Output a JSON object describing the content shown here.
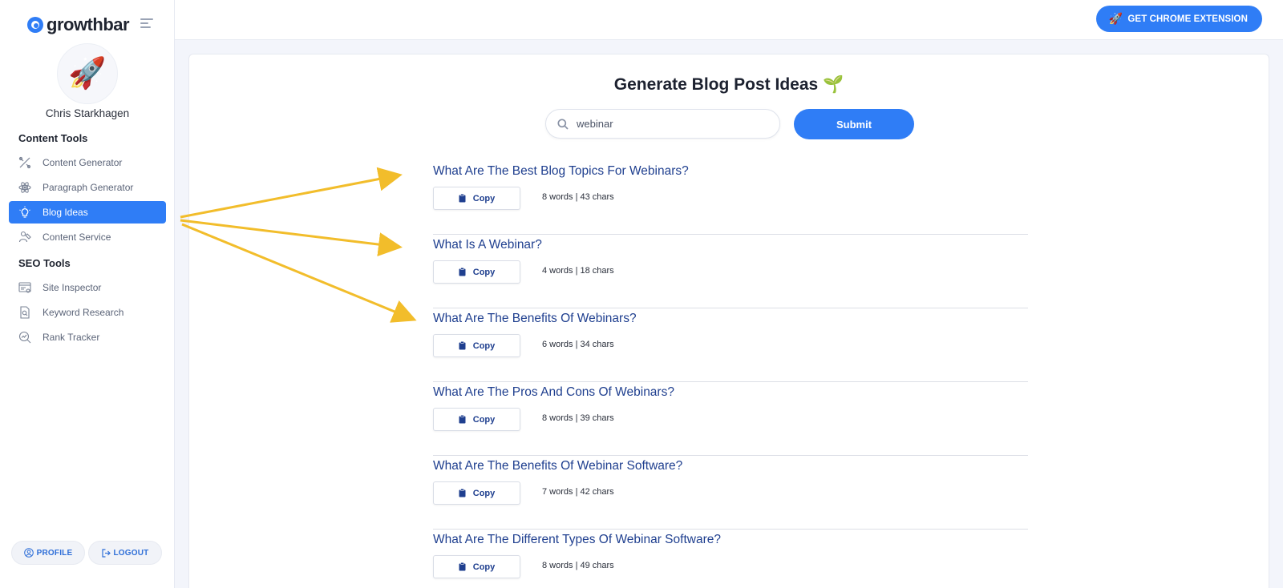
{
  "app": {
    "logo_text": "growthbar"
  },
  "user": {
    "name": "Chris Starkhagen",
    "avatar_emoji": "🚀"
  },
  "sidebar": {
    "sections": [
      {
        "title": "Content Tools",
        "items": [
          {
            "label": "Content Generator",
            "icon": "tools-icon"
          },
          {
            "label": "Paragraph Generator",
            "icon": "atom-icon"
          },
          {
            "label": "Blog Ideas",
            "icon": "lightbulb-icon",
            "active": true
          },
          {
            "label": "Content Service",
            "icon": "writer-icon"
          }
        ]
      },
      {
        "title": "SEO Tools",
        "items": [
          {
            "label": "Site Inspector",
            "icon": "browser-icon"
          },
          {
            "label": "Keyword Research",
            "icon": "document-search-icon"
          },
          {
            "label": "Rank Tracker",
            "icon": "magnify-chart-icon"
          }
        ]
      }
    ],
    "profile_label": "PROFILE",
    "logout_label": "LOGOUT"
  },
  "topbar": {
    "chrome_button_label": "GET CHROME EXTENSION",
    "chrome_button_emoji": "🚀"
  },
  "main": {
    "title": "Generate Blog Post Ideas",
    "title_emoji": "🌱",
    "search": {
      "value": "webinar",
      "placeholder": ""
    },
    "submit_label": "Submit",
    "copy_label": "Copy",
    "results": [
      {
        "title": "What Are The Best Blog Topics For Webinars?",
        "meta": "8 words | 43 chars"
      },
      {
        "title": "What Is A Webinar?",
        "meta": "4 words | 18 chars"
      },
      {
        "title": "What Are The Benefits Of Webinars?",
        "meta": "6 words | 34 chars"
      },
      {
        "title": "What Are The Pros And Cons Of Webinars?",
        "meta": "8 words | 39 chars"
      },
      {
        "title": "What Are The Benefits Of Webinar Software?",
        "meta": "7 words | 42 chars"
      },
      {
        "title": "What Are The Different Types Of Webinar Software?",
        "meta": "8 words | 49 chars"
      }
    ]
  },
  "colors": {
    "accent": "#2f7df6",
    "result_title": "#1f3f8f",
    "annotation_arrow": "#f2bd2b"
  }
}
